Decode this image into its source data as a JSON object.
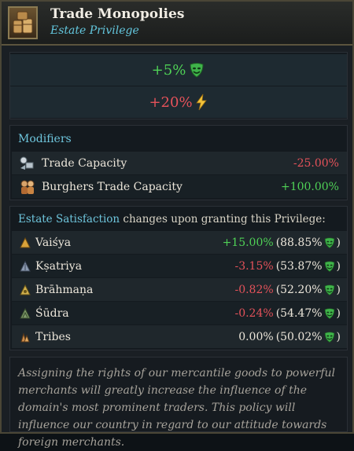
{
  "header": {
    "title": "Trade Monopolies",
    "subtitle": "Estate Privilege",
    "icon": "goods-crates-icon"
  },
  "effects": [
    {
      "text": "+5%",
      "icon": "mask-icon",
      "color": "#4fd156"
    },
    {
      "text": "+20%",
      "icon": "lightning-icon",
      "color": "#e5525a"
    }
  ],
  "modifiers": {
    "title": "Modifiers",
    "rows": [
      {
        "label": "Trade Capacity",
        "value": "-25.00%",
        "icon": "trade-capacity-icon",
        "color": "#e5525a"
      },
      {
        "label": "Burghers Trade Capacity",
        "value": "+100.00%",
        "icon": "burghers-icon",
        "color": "#4fd156"
      }
    ]
  },
  "estates": {
    "title_accent": "Estate Satisfaction",
    "title_rest": " changes upon granting this Privilege:",
    "rows": [
      {
        "name": "Vaiśya",
        "change": "+15.00%",
        "total": "(88.85%",
        "close": ")",
        "change_color": "#4fd156"
      },
      {
        "name": "Kṣatriya",
        "change": "-3.15%",
        "total": "(53.87%",
        "close": ")",
        "change_color": "#e5525a"
      },
      {
        "name": "Brāhmaṇa",
        "change": "-0.82%",
        "total": "(52.20%",
        "close": ")",
        "change_color": "#e5525a"
      },
      {
        "name": "Śūdra",
        "change": "-0.24%",
        "total": "(54.47%",
        "close": ")",
        "change_color": "#e5525a"
      },
      {
        "name": "Tribes",
        "change": "0.00%",
        "total": "(50.02%",
        "close": ")",
        "change_color": "#ece6da"
      }
    ]
  },
  "description": "Assigning the rights of our mercantile goods to powerful merchants will greatly increase the influence of the domain's most prominent traders. This policy will influence our country in regard to our attitude towards foreign merchants."
}
